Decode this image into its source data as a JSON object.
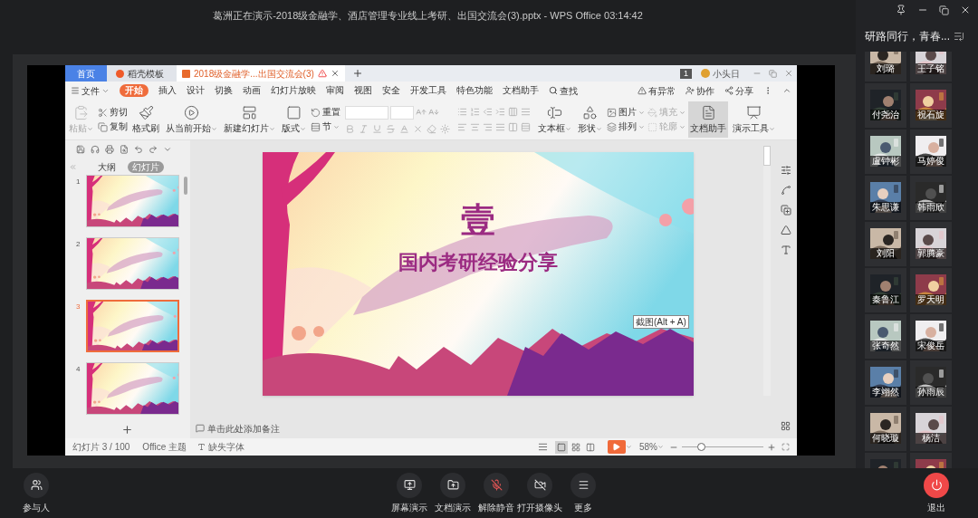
{
  "meeting": {
    "title": "葛洲正在演示-2018级金融学、酒店管理专业线上考研、出国交流会(3).pptx - WPS Office 03:14:42",
    "room_name": "研路同行，青春...",
    "participants": [
      {
        "kind": "member",
        "name": "刘璐"
      },
      {
        "kind": "member",
        "name": "王子铭"
      },
      {
        "kind": "member",
        "name": "付尧治"
      },
      {
        "kind": "member",
        "name": "祝石旋"
      },
      {
        "kind": "member",
        "name": "盧钟彬"
      },
      {
        "kind": "member",
        "name": "马婷俊"
      },
      {
        "kind": "member",
        "name": "朱思谦"
      },
      {
        "kind": "member",
        "name": "韩雨欣"
      },
      {
        "kind": "member",
        "name": "刘阳"
      },
      {
        "kind": "member",
        "name": "郭腾豪"
      },
      {
        "kind": "member",
        "name": "秦鲁江"
      },
      {
        "kind": "member",
        "name": "罗天明"
      },
      {
        "kind": "member",
        "name": "张奇然"
      },
      {
        "kind": "member",
        "name": "宋俊岳"
      },
      {
        "kind": "member",
        "name": "李翊然"
      },
      {
        "kind": "member",
        "name": "孙雨辰"
      },
      {
        "kind": "member",
        "name": "何晓璇"
      },
      {
        "kind": "member",
        "name": "杨洁"
      },
      {
        "kind": "picture"
      },
      {
        "kind": "picture"
      }
    ],
    "participants_button": "参与人",
    "controls": [
      {
        "label": "屏幕演示",
        "kind": "screen"
      },
      {
        "label": "文档演示",
        "kind": "document"
      },
      {
        "label": "解除静音",
        "kind": "mic"
      },
      {
        "label": "打开摄像头",
        "kind": "camera"
      },
      {
        "label": "更多",
        "kind": "more"
      }
    ],
    "leave_button": "退出"
  },
  "wps": {
    "tabs": [
      {
        "label": "首页",
        "kind": "home",
        "selected": false
      },
      {
        "label": "稻壳模板",
        "kind": "template",
        "selected": false
      },
      {
        "label": "2018级金融学...出国交流会(3)",
        "kind": "document",
        "selected": true
      }
    ],
    "notification_count": "1",
    "user_name": "小头日",
    "file_menu": "文件",
    "menu": [
      {
        "label": "开始",
        "selected": true
      },
      {
        "label": "插入",
        "selected": false
      },
      {
        "label": "设计",
        "selected": false
      },
      {
        "label": "切换",
        "selected": false
      },
      {
        "label": "动画",
        "selected": false
      },
      {
        "label": "幻灯片放映",
        "selected": false
      },
      {
        "label": "审阅",
        "selected": false
      },
      {
        "label": "视图",
        "selected": false
      },
      {
        "label": "安全",
        "selected": false
      },
      {
        "label": "开发工具",
        "selected": false
      },
      {
        "label": "特色功能",
        "selected": false
      },
      {
        "label": "文档助手",
        "selected": false
      }
    ],
    "search": "查找",
    "menu_actions": [
      "有异常",
      "协作",
      "分享"
    ],
    "ribbon": [
      {
        "kind": "large",
        "label": "粘贴",
        "dropdown": true,
        "disabled": true
      },
      {
        "kind": "stack",
        "items": [
          {
            "label": "剪切"
          },
          {
            "label": "复制"
          }
        ]
      },
      {
        "kind": "large",
        "label": "格式刷"
      },
      {
        "kind": "large",
        "label": "从当前开始",
        "dropdown": true
      },
      {
        "kind": "large",
        "label": "新建幻灯片",
        "dropdown": true
      },
      {
        "kind": "large",
        "label": "版式",
        "dropdown": true
      },
      {
        "kind": "stack",
        "items": [
          {
            "label": "重置"
          },
          {
            "label": "节",
            "dropdown": true
          }
        ]
      },
      {
        "kind": "font",
        "disabled": true
      },
      {
        "kind": "paragraph",
        "disabled": true
      },
      {
        "kind": "large",
        "label": "文本框",
        "dropdown": true
      },
      {
        "kind": "large",
        "label": "形状",
        "dropdown": true
      },
      {
        "kind": "stack",
        "items": [
          {
            "label": "图片",
            "dropdown": true
          },
          {
            "label": "排列",
            "dropdown": true
          }
        ]
      },
      {
        "kind": "stack",
        "items": [
          {
            "label": "填充",
            "dropdown": true,
            "disabled": true
          },
          {
            "label": "轮廓",
            "dropdown": true,
            "disabled": true
          }
        ]
      },
      {
        "kind": "large",
        "label": "文档助手",
        "selected": true
      },
      {
        "kind": "large",
        "label": "演示工具",
        "dropdown": true
      }
    ],
    "pane_tabs": [
      {
        "label": "大纲",
        "selected": false
      },
      {
        "label": "幻灯片",
        "selected": true
      }
    ],
    "thumbnails": [
      {
        "number": "1",
        "selected": false
      },
      {
        "number": "2",
        "selected": false
      },
      {
        "number": "3",
        "selected": true
      },
      {
        "number": "4",
        "selected": false
      }
    ],
    "slide": {
      "heading": "壹",
      "subtitle": "国内考研经验分享"
    },
    "tooltip": "截图(Alt + A)",
    "notes_placeholder": "单击此处添加备注",
    "status": {
      "slide_counter": "幻灯片 3 / 100",
      "theme": "Office 主题",
      "missing_fonts": "缺失字体",
      "zoom": "58%",
      "zoom_slider": {
        "level": 0.23
      }
    }
  }
}
